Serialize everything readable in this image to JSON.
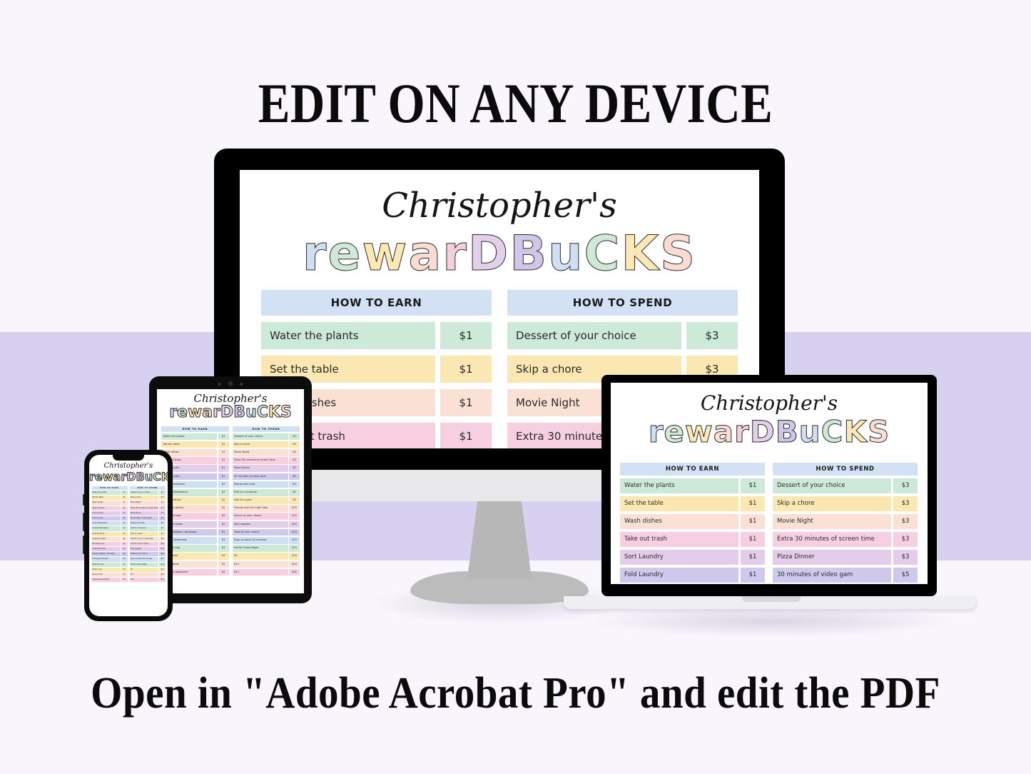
{
  "banner": {
    "top_text": "EDIT ON ANY DEVICE",
    "bottom_text": "Open in \"Adobe Acrobat Pro\" and edit the PDF"
  },
  "theme": {
    "page_background": "#f8f5fc",
    "band_color": "#d7d0f0",
    "header_blue": "#d2e1f4",
    "row_palette": [
      "#cde9d8",
      "#fbe7b2",
      "#fbe0d6",
      "#f7cfe0",
      "#e4cdea",
      "#cfc9ee",
      "#cfe0f5"
    ]
  },
  "poster": {
    "name_script": "Christopher's",
    "title_bubble": "reward Bucks",
    "title_letters": [
      {
        "ch": "r",
        "color": "b-blue"
      },
      {
        "ch": "e",
        "color": "b-green"
      },
      {
        "ch": "w",
        "color": "b-yellow"
      },
      {
        "ch": "a",
        "color": "b-peach"
      },
      {
        "ch": "r",
        "color": "b-pink"
      },
      {
        "ch": "D",
        "color": "b-lilac"
      },
      {
        "ch": "B",
        "color": "b-violet"
      },
      {
        "ch": "u",
        "color": "b-blue"
      },
      {
        "ch": "C",
        "color": "b-green"
      },
      {
        "ch": "K",
        "color": "b-yellow"
      },
      {
        "ch": "S",
        "color": "b-peach"
      }
    ],
    "earn": {
      "header": "HOW TO EARN",
      "rows": [
        {
          "label": "Water the plants",
          "value": "$1"
        },
        {
          "label": "Set the table",
          "value": "$1"
        },
        {
          "label": "Wash dishes",
          "value": "$1"
        },
        {
          "label": "Take out trash",
          "value": "$1"
        },
        {
          "label": "Sort Laundry",
          "value": "$1"
        },
        {
          "label": "Fold Laundry",
          "value": "$1"
        },
        {
          "label": "Load Dishwasher",
          "value": "$2"
        },
        {
          "label": "Unload Dishwasher",
          "value": "$2"
        },
        {
          "label": "Dust furniture",
          "value": "$2"
        },
        {
          "label": "Organize pantry",
          "value": "$2"
        },
        {
          "label": "Put away toys",
          "value": "$2"
        },
        {
          "label": "Organize shoes",
          "value": "$2"
        },
        {
          "label": "Sweep hallway / entryway",
          "value": "$2"
        },
        {
          "label": "Change bedsheets",
          "value": "$3"
        },
        {
          "label": "Walk the dog",
          "value": "$3"
        },
        {
          "label": "Clean room",
          "value": "$3"
        },
        {
          "label": "Read a book",
          "value": "$3"
        },
        {
          "label": "Organize bookshelf",
          "value": "$3"
        }
      ]
    },
    "spend": {
      "header": "HOW TO SPEND",
      "rows": [
        {
          "label": "Dessert of your choice",
          "value": "$3"
        },
        {
          "label": "Skip a chore",
          "value": "$3"
        },
        {
          "label": "Movie Night",
          "value": "$3"
        },
        {
          "label": "Extra 30 minutes of screen time",
          "value": "$3"
        },
        {
          "label": "Pizza Dinner",
          "value": "$3"
        },
        {
          "label": "30 minutes of video gam",
          "value": "$5"
        },
        {
          "label": "Restaurant treat",
          "value": "$5"
        },
        {
          "label": "Visit to a museum",
          "value": "$5"
        },
        {
          "label": "Visit to a park",
          "value": "$5"
        },
        {
          "label": "Friends over for night stay",
          "value": "$10"
        },
        {
          "label": "Dinner of your choice",
          "value": "$10"
        },
        {
          "label": "Skip veggies",
          "value": "$10"
        },
        {
          "label": "Treat of your choice",
          "value": "$10"
        },
        {
          "label": "Stay up extra 30 minutes",
          "value": "$10"
        },
        {
          "label": "Family Game Night",
          "value": "$10"
        },
        {
          "label": "$5",
          "value": "$10"
        },
        {
          "label": "$10",
          "value": "$20"
        },
        {
          "label": "$15",
          "value": "$30"
        }
      ]
    }
  },
  "devices": {
    "monitor": {
      "name": "desktop-monitor",
      "visible_rows": 5
    },
    "laptop": {
      "name": "laptop",
      "visible_rows": 6
    },
    "tablet": {
      "name": "tablet",
      "visible_rows": 18
    },
    "phone": {
      "name": "phone",
      "visible_rows": 18
    }
  }
}
